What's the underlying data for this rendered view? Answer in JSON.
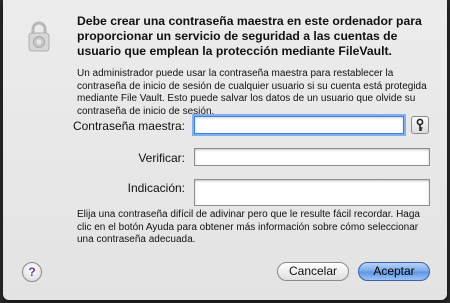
{
  "dialog": {
    "title": "Debe crear una contraseña maestra en este ordenador para proporcionar un servicio de seguridad a las cuentas de usuario que emplean la protección mediante FileVault.",
    "description": "Un administrador puede usar la contraseña maestra para restablecer la contraseña de inicio de sesión de cualquier usuario si su cuenta está protegida mediante File Vault. Esto puede salvar los datos de un usuario que olvide su contraseña de inicio de sesión.",
    "fields": {
      "master_password_label": "Contraseña maestra:",
      "master_password_value": "",
      "verify_label": "Verificar:",
      "verify_value": "",
      "hint_label": "Indicación:",
      "hint_value": ""
    },
    "hint_text": "Elija una contraseña difícil de adivinar pero que le resulte fácil recordar. Haga clic en el botón Ayuda para obtener más información sobre cómo seleccionar una contraseña adecuada.",
    "help_label": "?",
    "cancel_label": "Cancelar",
    "accept_label": "Aceptar"
  },
  "icons": {
    "lock": "lock-icon",
    "key": "key-icon",
    "help": "help-icon"
  },
  "colors": {
    "accent": "#5a95e4",
    "focus_ring": "#7fb1f2",
    "help_glyph": "#6a3fa0"
  }
}
